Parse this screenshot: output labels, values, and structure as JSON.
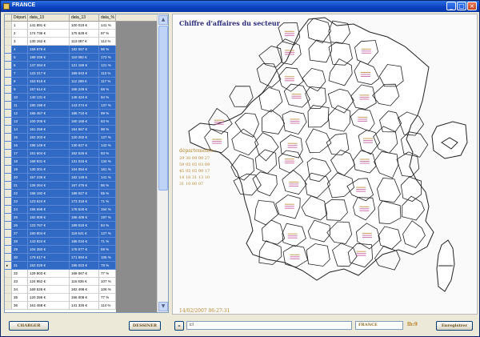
{
  "window": {
    "title": "FRANCE",
    "controls": [
      "_",
      "□",
      "×"
    ]
  },
  "grid": {
    "columns": [
      "",
      "Départ.",
      "data_13",
      "data_13",
      "data_%"
    ],
    "row_indicator_glyph": "▸",
    "rows": [
      {
        "num": "1",
        "a": "141 891 €",
        "b": "100 019 €",
        "c": "141 %",
        "selected": false
      },
      {
        "num": "2",
        "a": "174 736 €",
        "b": "175 628 €",
        "c": "97 %",
        "selected": false
      },
      {
        "num": "3",
        "a": "130 162 €",
        "b": "113 087 €",
        "c": "114 %",
        "selected": false
      },
      {
        "num": "4",
        "a": "159 878 €",
        "b": "182 067 €",
        "c": "86 %",
        "selected": true
      },
      {
        "num": "5",
        "a": "189 339 €",
        "b": "110 082 €",
        "c": "172 %",
        "selected": true
      },
      {
        "num": "6",
        "a": "147 264 €",
        "b": "121 169 €",
        "c": "121 %",
        "selected": true
      },
      {
        "num": "7",
        "a": "123 317 €",
        "b": "189 043 €",
        "c": "113 %",
        "selected": true
      },
      {
        "num": "8",
        "a": "153 919 €",
        "b": "112 289 €",
        "c": "117 %",
        "selected": true
      },
      {
        "num": "9",
        "a": "157 614 €",
        "b": "165 249 €",
        "c": "68 %",
        "selected": true
      },
      {
        "num": "10",
        "a": "140 131 €",
        "b": "148 424 €",
        "c": "94 %",
        "selected": true
      },
      {
        "num": "11",
        "a": "180 198 €",
        "b": "143 274 €",
        "c": "137 %",
        "selected": true
      },
      {
        "num": "12",
        "a": "186 467 €",
        "b": "186 716 €",
        "c": "99 %",
        "selected": true
      },
      {
        "num": "13",
        "a": "100 206 €",
        "b": "160 168 €",
        "c": "63 %",
        "selected": true
      },
      {
        "num": "14",
        "a": "161 269 €",
        "b": "164 657 €",
        "c": "98 %",
        "selected": true
      },
      {
        "num": "15",
        "a": "152 203 €",
        "b": "120 202 €",
        "c": "127 %",
        "selected": true
      },
      {
        "num": "16",
        "a": "195 149 €",
        "b": "130 627 €",
        "c": "142 %",
        "selected": true
      },
      {
        "num": "17",
        "a": "151 604 €",
        "b": "162 526 €",
        "c": "93 %",
        "selected": true
      },
      {
        "num": "18",
        "a": "169 931 €",
        "b": "131 016 €",
        "c": "134 %",
        "selected": true
      },
      {
        "num": "19",
        "a": "130 301 €",
        "b": "104 054 €",
        "c": "161 %",
        "selected": true
      },
      {
        "num": "20",
        "a": "157 236 €",
        "b": "182 149 €",
        "c": "141 %",
        "selected": true
      },
      {
        "num": "21",
        "a": "126 264 €",
        "b": "167 476 €",
        "c": "86 %",
        "selected": true
      },
      {
        "num": "22",
        "a": "158 192 €",
        "b": "188 027 €",
        "c": "55 %",
        "selected": true
      },
      {
        "num": "23",
        "a": "123 624 €",
        "b": "173 318 €",
        "c": "71 %",
        "selected": true
      },
      {
        "num": "24",
        "a": "195 698 €",
        "b": "178 526 €",
        "c": "164 %",
        "selected": true
      },
      {
        "num": "25",
        "a": "182 809 €",
        "b": "186 409 €",
        "c": "197 %",
        "selected": true
      },
      {
        "num": "26",
        "a": "123 767 €",
        "b": "189 518 €",
        "c": "84 %",
        "selected": true
      },
      {
        "num": "27",
        "a": "150 804 €",
        "b": "118 641 €",
        "c": "127 %",
        "selected": true
      },
      {
        "num": "28",
        "a": "143 924 €",
        "b": "186 016 €",
        "c": "71 %",
        "selected": true
      },
      {
        "num": "29",
        "a": "104 350 €",
        "b": "176 077 €",
        "c": "59 %",
        "selected": true
      },
      {
        "num": "30",
        "a": "179 617 €",
        "b": "171 594 €",
        "c": "105 %",
        "selected": true
      },
      {
        "num": "31",
        "a": "152 028 €",
        "b": "195 023 €",
        "c": "78 %",
        "selected": true
      },
      {
        "num": "32",
        "a": "129 803 €",
        "b": "168 067 €",
        "c": "77 %",
        "selected": false
      },
      {
        "num": "33",
        "a": "124 952 €",
        "b": "116 836 €",
        "c": "107 %",
        "selected": false
      },
      {
        "num": "34",
        "a": "169 526 €",
        "b": "182 498 €",
        "c": "106 %",
        "selected": false
      },
      {
        "num": "35",
        "a": "120 286 €",
        "b": "156 008 €",
        "c": "77 %",
        "selected": false
      },
      {
        "num": "36",
        "a": "161 468 €",
        "b": "141 326 €",
        "c": "114 %",
        "selected": false
      }
    ],
    "current_row_index": 30
  },
  "map": {
    "title": "Chiffre d'affaires du secteur",
    "dept_heading": "départements :",
    "dept_lines": [
      "29 30 09 09 27",
      "59 05 05 03 09",
      "45 05 05 09 17",
      "14 18 31 13 10",
      "31 10 00 07"
    ],
    "timestamp": "14/02/2007 06:27:31",
    "label_color": "#b8842a",
    "pin_color": "#c0509a",
    "dept_stroke": "#222222"
  },
  "bottom": {
    "charger_label": "CHARGER",
    "dessiner_label": "DESSINER",
    "minus_label": "–",
    "path_value": "c:\\",
    "region_value": "FRANCE",
    "fps_label": "lb:9",
    "enregistrer_label": "Enregistrer"
  }
}
